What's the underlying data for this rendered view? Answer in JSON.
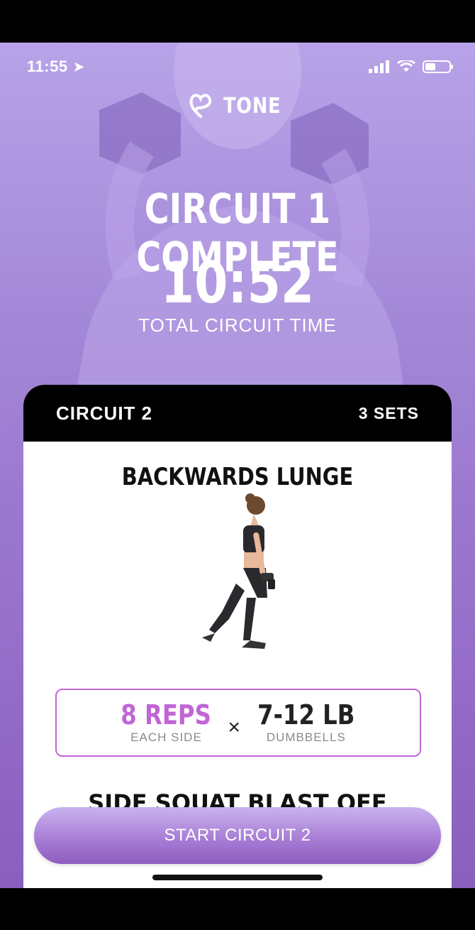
{
  "status_bar": {
    "time": "11:55"
  },
  "logo": {
    "brand": "TONE"
  },
  "header": {
    "headline": "CIRCUIT 1 COMPLETE",
    "total_time": "10:52",
    "total_time_label": "TOTAL CIRCUIT TIME"
  },
  "card": {
    "title": "CIRCUIT 2",
    "sets": "3 SETS",
    "exercise": {
      "name": "BACKWARDS LUNGE",
      "reps": "8 REPS",
      "reps_sub": "EACH SIDE",
      "times": "×",
      "weight": "7-12 LB",
      "weight_sub": "DUMBBELLS"
    },
    "next_exercise_peek": "SIDE SQUAT BLAST OFF"
  },
  "cta": {
    "label": "START CIRCUIT 2"
  },
  "colors": {
    "accent": "#c165d6",
    "bg_top": "#b7a3e8",
    "bg_bottom": "#8a5fbe"
  }
}
